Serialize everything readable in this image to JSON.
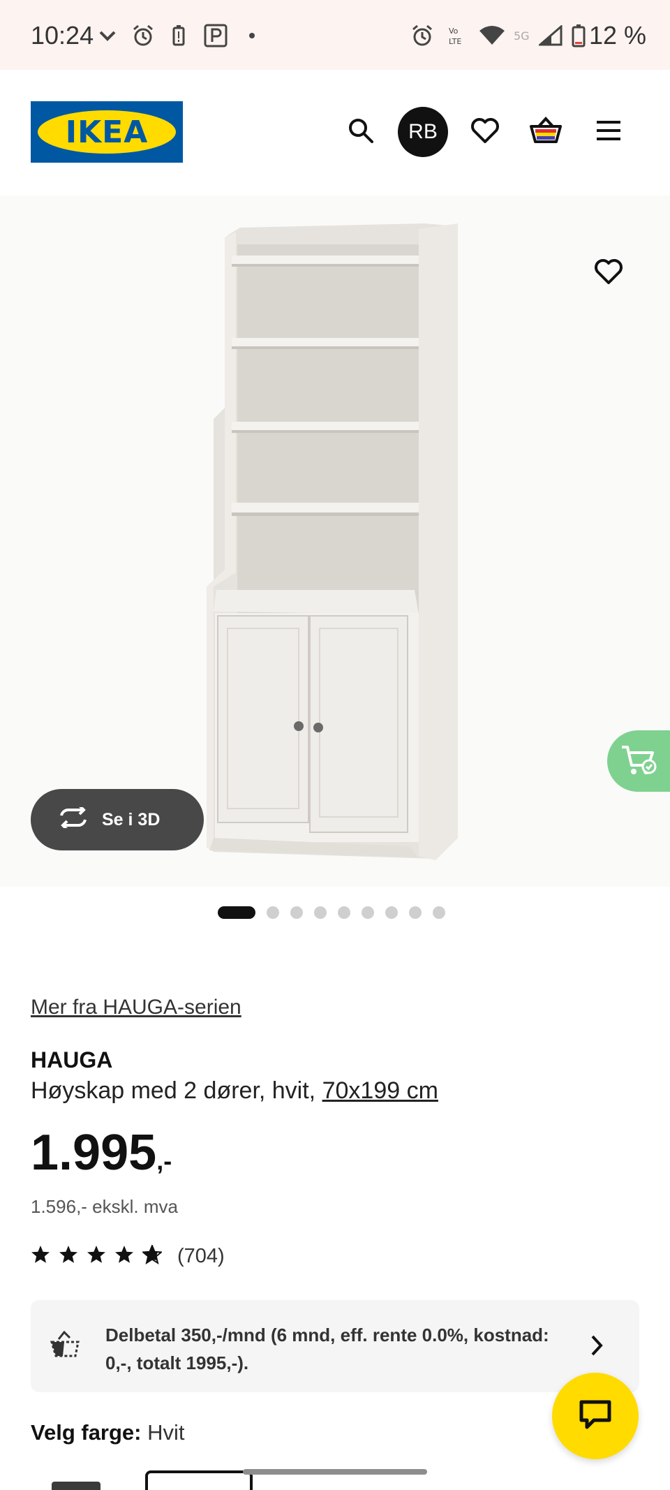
{
  "status_bar": {
    "time": "10:24",
    "battery": "12 %"
  },
  "header": {
    "logo_text": "IKEA",
    "avatar_initials": "RB"
  },
  "gallery": {
    "view_3d_label": "Se i 3D",
    "slide_count": 9,
    "active_slide": 1
  },
  "product": {
    "series_link": "Mer fra HAUGA-serien",
    "name": "HAUGA",
    "description": "Høyskap med 2 dører, hvit, ",
    "size": "70x199 cm",
    "price": "1.995",
    "price_suffix": ",-",
    "price_ex_vat": "1.596,- ekskl. mva",
    "rating_stars": 4.5,
    "review_count": "(704)"
  },
  "financing": {
    "text": "Delbetal 350,-/mnd (6 mnd, eff. rente 0.0%, kostnad: 0,-, totalt 1995,-)."
  },
  "colour": {
    "label": "Velg farge:",
    "value": "Hvit"
  },
  "colors": {
    "ikea_blue": "#0058a3",
    "ikea_yellow": "#ffdb00",
    "cart_green": "#7fd18f"
  },
  "icons": [
    "search-icon",
    "heart-icon",
    "basket-icon",
    "menu-icon",
    "rotate-icon",
    "add-to-cart-icon",
    "payment-icon",
    "chevron-right-icon",
    "chat-icon",
    "star-icon"
  ]
}
